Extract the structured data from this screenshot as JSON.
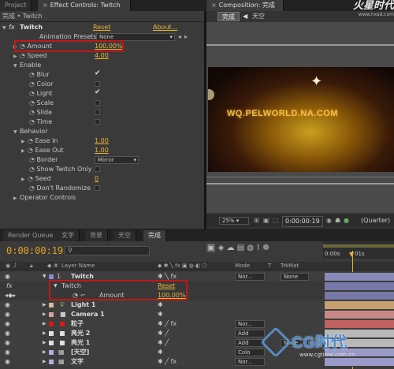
{
  "left_tabs": [
    "Project",
    "Effect Controls: Twitch"
  ],
  "right_tab": "Composition: 完成",
  "breadcrumb": "完成 • Twitch",
  "effect": {
    "name": "Twitch",
    "reset": "Reset",
    "about": "About..."
  },
  "presets": {
    "label": "Animation Presets:",
    "value": "None"
  },
  "props": [
    {
      "name": "Amount",
      "value": "100.00%"
    },
    {
      "name": "Speed",
      "value": "4.00"
    },
    {
      "name": "Enable"
    },
    {
      "name": "Blur",
      "checked": true
    },
    {
      "name": "Color",
      "checked": false
    },
    {
      "name": "Light",
      "checked": true
    },
    {
      "name": "Scale",
      "checked": false
    },
    {
      "name": "Slide",
      "checked": false
    },
    {
      "name": "Time",
      "checked": false
    },
    {
      "name": "Behavior"
    },
    {
      "name": "Ease In",
      "value": "1.00"
    },
    {
      "name": "Ease Out",
      "value": "1.00"
    },
    {
      "name": "Border",
      "value": "Mirror"
    },
    {
      "name": "Show Twitch Only"
    },
    {
      "name": "Seed",
      "value": "0"
    },
    {
      "name": "Don't Randomize"
    },
    {
      "name": "Operator Controls"
    }
  ],
  "comp_tabs": [
    "完成",
    "天空"
  ],
  "comp_text": "WQ.PELWORLD.NA.COM",
  "viewer": {
    "zoom": "25%",
    "time": "0:00:00:19",
    "quality": "(Quarter)"
  },
  "timeline_tabs": [
    "Render Queue",
    "文字",
    "背景",
    "天空",
    "完成"
  ],
  "current_time": "0:00:00:19",
  "columns": {
    "layer_name": "Layer Name",
    "mode": "Mode",
    "t": "T",
    "trkmat": "TrkMat"
  },
  "ruler": [
    "0:00s",
    "01s"
  ],
  "layers": [
    {
      "num": "1",
      "name": "Twitch",
      "mode": "Nor...",
      "trkmat": "None",
      "color": "#8a8ad0",
      "expanded": true
    },
    {
      "num": "",
      "name": "Twitch",
      "reset": "Reset",
      "sub": true
    },
    {
      "num": "",
      "name": "Amount",
      "value": "100.00%",
      "sub2": true
    },
    {
      "num": "2",
      "name": "Light 1",
      "color": "#d8b898"
    },
    {
      "num": "3",
      "name": "Camera 1",
      "color": "#d8a0a0"
    },
    {
      "num": "4",
      "name": "粒子",
      "mode": "Nor...",
      "color": "#d81818"
    },
    {
      "num": "5",
      "name": "亮光 2",
      "mode": "Add",
      "color": "#e0e0e0"
    },
    {
      "num": "6",
      "name": "亮光 1",
      "mode": "Add",
      "trkmat": "None",
      "color": "#e0e0e0"
    },
    {
      "num": "7",
      "name": "[天空]",
      "mode": "Colo",
      "color": "#b0b0e0"
    },
    {
      "num": "8",
      "name": "文字",
      "mode": "Nor...",
      "color": "#b0b0e0"
    }
  ],
  "watermark_top": "火星时代",
  "watermark_top_url": "www.hxsd.com",
  "watermark_bottom": "CG时代",
  "watermark_bottom_url": "www.cgtime.com.cn"
}
